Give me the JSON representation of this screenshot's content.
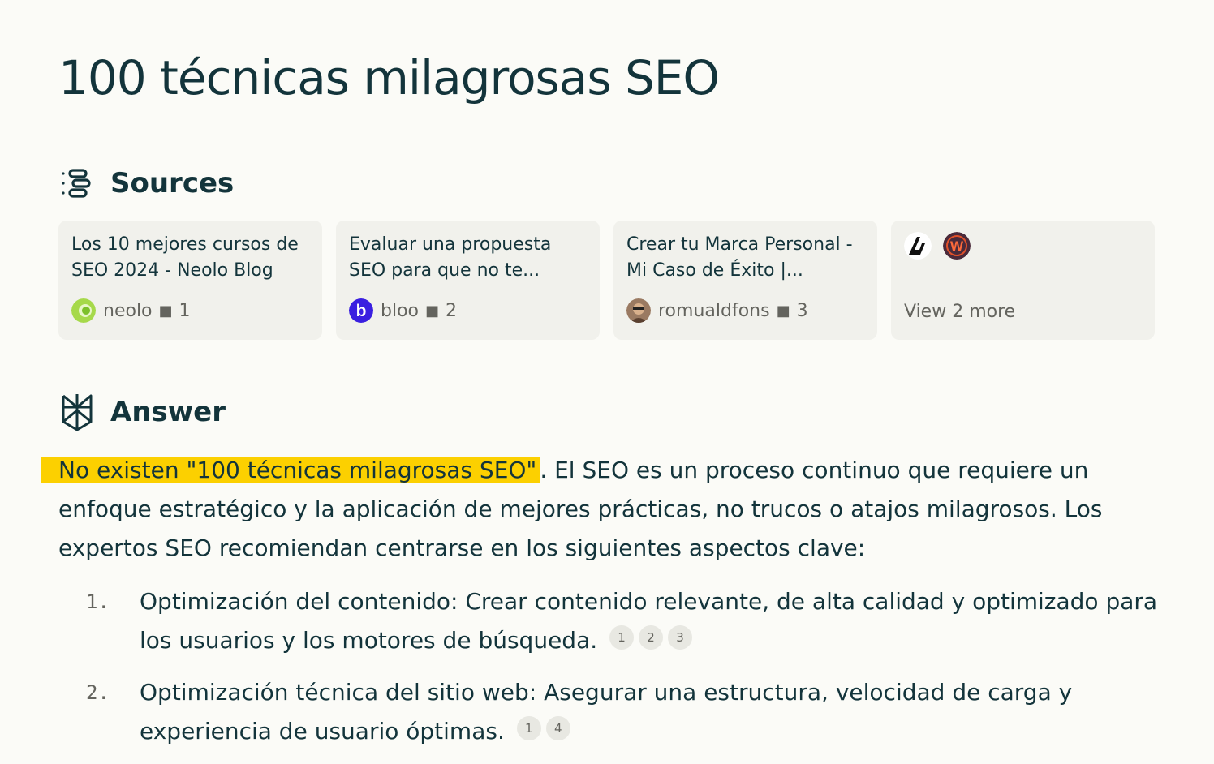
{
  "title": "100 técnicas milagrosas SEO",
  "sources": {
    "heading": "Sources",
    "cards": [
      {
        "title": "Los 10 mejores cursos de SEO 2024 - Neolo Blog",
        "site": "neolo",
        "index": "1"
      },
      {
        "title": "Evaluar una propuesta SEO para que no te...",
        "site": "bloo",
        "index": "2"
      },
      {
        "title": "Crear tu Marca Personal - Mi Caso de Éxito |...",
        "site": "romualdfons",
        "index": "3"
      }
    ],
    "more_label": "View 2 more"
  },
  "answer": {
    "heading": "Answer",
    "highlight": "No existen \"100 técnicas milagrosas SEO\"",
    "rest": ". El SEO es un proceso continuo que requiere un enfoque estratégico y la aplicación de mejores prácticas, no trucos o atajos milagrosos. Los expertos SEO recomiendan centrarse en los siguientes aspectos clave:",
    "items": [
      {
        "num": "1.",
        "text": "Optimización del contenido: Crear contenido relevante, de alta calidad y optimizado para los usuarios y los motores de búsqueda.",
        "cites": [
          "1",
          "2",
          "3"
        ]
      },
      {
        "num": "2.",
        "text": "Optimización técnica del sitio web: Asegurar una estructura, velocidad de carga y experiencia de usuario óptimas.",
        "cites": [
          "1",
          "4"
        ]
      }
    ]
  },
  "colors": {
    "highlight": "#fcd000",
    "text": "#13343b",
    "card_bg": "#f1f1ec"
  },
  "icons": {
    "sources": "sources-list-icon",
    "answer": "perplexity-logo-icon"
  }
}
